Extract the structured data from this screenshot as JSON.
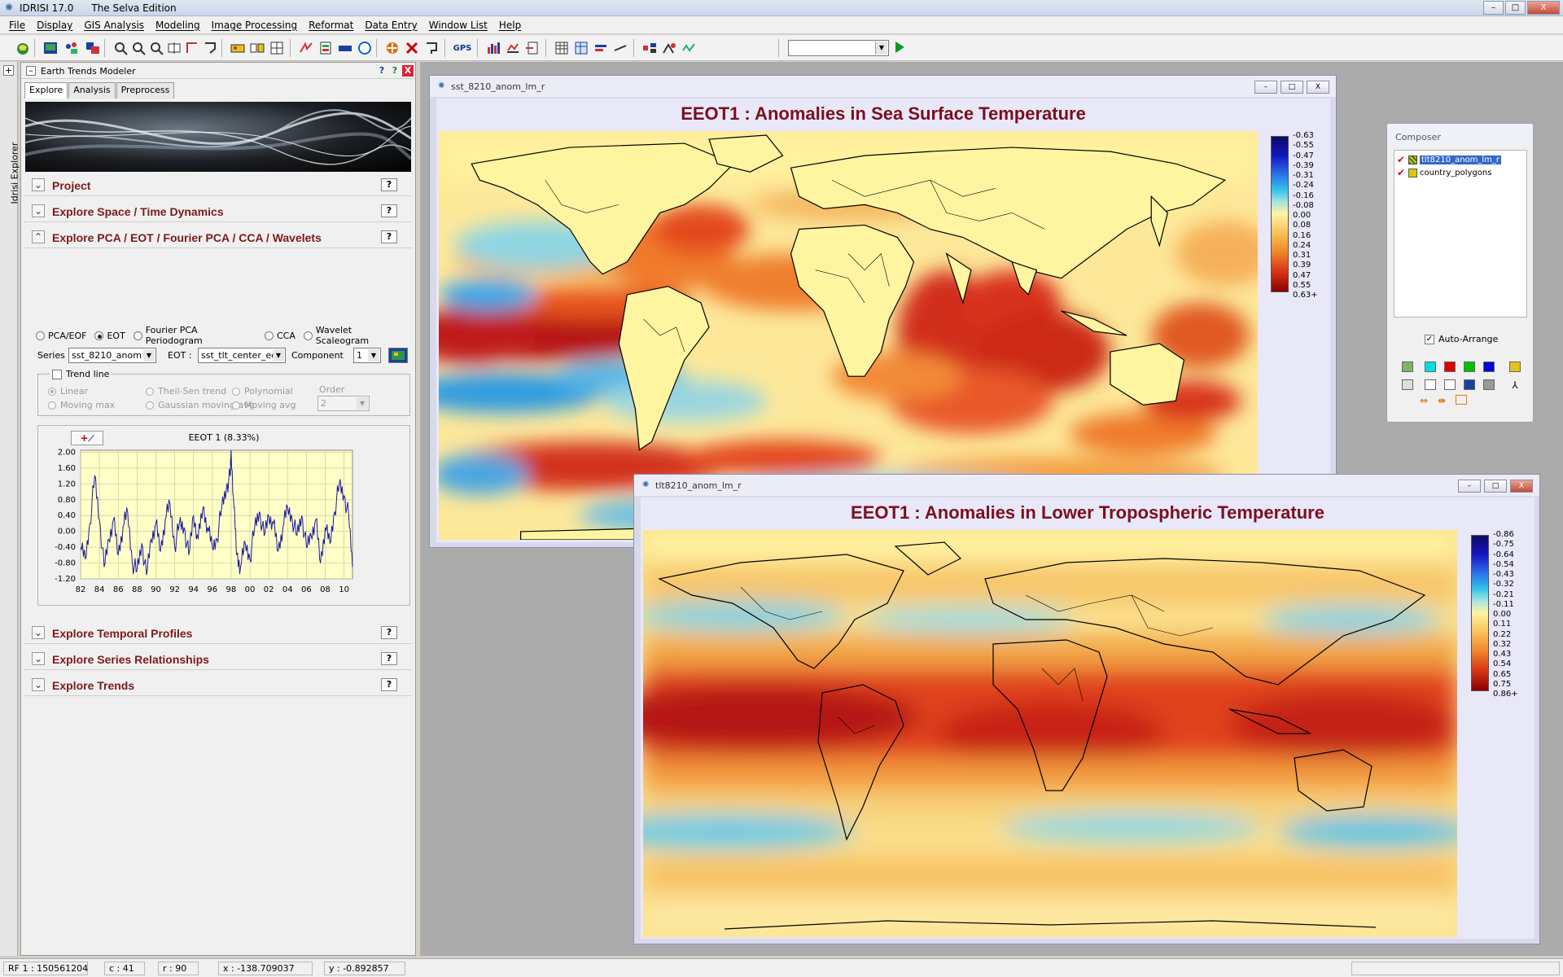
{
  "window": {
    "app_name": "IDRISI 17.0",
    "edition": "The Selva Edition",
    "min_label": "–",
    "max_label": "□",
    "close_label": "X"
  },
  "menu": [
    "File",
    "Display",
    "GIS Analysis",
    "Modeling",
    "Image Processing",
    "Reformat",
    "Data Entry",
    "Window List",
    "Help"
  ],
  "toolbar": {
    "gps_label": "GPS",
    "icons": [
      "new-project-icon",
      "display-launcher-icon",
      "add-layer-icon",
      "composer-icon",
      "zoom-window-icon",
      "zoom-in-icon",
      "zoom-out-icon",
      "pan-icon",
      "measure-icon",
      "query-icon",
      "digitize-icon",
      "shortcut-icon",
      "globe-icon",
      "feature-properties-icon",
      "delete-feature-icon",
      "save-digitized-icon",
      "gps-icon",
      "histogram-icon",
      "profile-icon",
      "export-icon",
      "grid-table-icon",
      "spreadsheet-icon",
      "stretch-icon",
      "legend-edit-icon",
      "macro-icon",
      "model-icon"
    ],
    "combo_value": "",
    "run_label": "run"
  },
  "side_strip": {
    "expand_label": "+",
    "vertical_label": "Idrisi Explorer"
  },
  "etm": {
    "title": "Earth Trends Modeler",
    "collapse_label": "–",
    "help_label": "?",
    "help2_label": "?",
    "close_label": "X",
    "tabs": [
      "Explore",
      "Analysis",
      "Preprocess"
    ],
    "sections_top": [
      "Project",
      "Explore Space / Time Dynamics",
      "Explore PCA / EOT / Fourier PCA / CCA / Wavelets"
    ],
    "sections_bottom": [
      "Explore Temporal Profiles",
      "Explore Series Relationships",
      "Explore Trends"
    ],
    "help_btn": "?",
    "radios": [
      {
        "label": "PCA/EOF",
        "selected": false
      },
      {
        "label": "EOT",
        "selected": true
      },
      {
        "label": "Fourier PCA Periodogram",
        "selected": false
      },
      {
        "label": "CCA",
        "selected": false
      },
      {
        "label": "Wavelet Scaleogram",
        "selected": false
      }
    ],
    "series_label": "Series :",
    "series_value": "sst_8210_anom",
    "eot_label": "EOT :",
    "eot_value": "sst_tlt_center_eec",
    "component_label": "Component",
    "component_value": "1",
    "trend_line_label": "Trend line",
    "trend_options": [
      "Linear",
      "Theil-Sen trend",
      "Polynomial",
      "Moving max",
      "Gaussian moving avg",
      "Moving avg"
    ],
    "order_label": "Order",
    "order_value": "2",
    "plot_button": "+",
    "chart_title": "EEOT 1 (8.33%)"
  },
  "chart_data": {
    "type": "line",
    "title": "EEOT 1 (8.33%)",
    "xlabel": "",
    "ylabel": "",
    "x_ticks": [
      "82",
      "84",
      "86",
      "88",
      "90",
      "92",
      "94",
      "96",
      "98",
      "00",
      "02",
      "04",
      "06",
      "08",
      "10"
    ],
    "y_ticks": [
      "2.00",
      "1.60",
      "1.20",
      "0.80",
      "0.40",
      "0.00",
      "-0.40",
      "-0.80",
      "-1.20"
    ],
    "xlim": [
      1982,
      2010.9
    ],
    "ylim": [
      -1.2,
      2.05
    ],
    "grid": true,
    "series": [
      {
        "color": "#1a1aa0",
        "x": [
          1982.0,
          1982.5,
          1983.0,
          1983.5,
          1984.0,
          1984.5,
          1985.0,
          1985.5,
          1986.0,
          1986.5,
          1987.0,
          1987.5,
          1988.0,
          1988.5,
          1989.0,
          1989.5,
          1990.0,
          1990.5,
          1991.0,
          1991.5,
          1992.0,
          1992.5,
          1993.0,
          1993.5,
          1994.0,
          1994.5,
          1995.0,
          1995.5,
          1996.0,
          1996.5,
          1997.0,
          1997.5,
          1997.9,
          1998.0,
          1998.3,
          1998.6,
          1999.0,
          1999.5,
          2000.0,
          2000.5,
          2001.0,
          2001.5,
          2002.0,
          2002.5,
          2003.0,
          2003.5,
          2004.0,
          2004.5,
          2005.0,
          2005.5,
          2006.0,
          2006.5,
          2007.0,
          2007.5,
          2008.0,
          2008.5,
          2009.0,
          2009.5,
          2010.0,
          2010.5,
          2010.9
        ],
        "y": [
          -0.4,
          -0.7,
          0.2,
          1.4,
          0.3,
          -0.9,
          -0.2,
          0.3,
          -0.6,
          0.1,
          0.5,
          -0.8,
          -1.0,
          -0.3,
          -1.1,
          -0.2,
          0.2,
          -0.5,
          0.3,
          0.7,
          -0.4,
          0.2,
          0.1,
          -0.6,
          0.4,
          -0.2,
          0.6,
          0.1,
          -0.4,
          -0.2,
          0.6,
          1.1,
          1.4,
          2.05,
          0.6,
          -0.6,
          -0.9,
          -0.3,
          -0.7,
          0.1,
          0.5,
          -0.1,
          0.4,
          0.2,
          -0.5,
          0.1,
          0.6,
          0.3,
          -0.1,
          0.4,
          -0.4,
          -0.1,
          0.3,
          -0.8,
          0.1,
          -0.3,
          0.5,
          1.2,
          0.9,
          0.4,
          -0.9
        ]
      }
    ]
  },
  "sst_window": {
    "title": "sst_8210_anom_lm_r",
    "heading": "EEOT1 : Anomalies in Sea Surface Temperature",
    "legend": [
      "-0.63",
      "-0.55",
      "-0.47",
      "-0.39",
      "-0.31",
      "-0.24",
      "-0.16",
      "-0.08",
      "0.00",
      "0.08",
      "0.16",
      "0.24",
      "0.31",
      "0.39",
      "0.47",
      "0.55",
      "0.63+"
    ]
  },
  "tlt_window": {
    "title": "tlt8210_anom_lm_r",
    "heading": "EEOT1 : Anomalies in Lower Tropospheric Temperature",
    "legend": [
      "-0.86",
      "-0.75",
      "-0.64",
      "-0.54",
      "-0.43",
      "-0.32",
      "-0.21",
      "-0.11",
      "0.00",
      "0.11",
      "0.22",
      "0.32",
      "0.43",
      "0.54",
      "0.65",
      "0.75",
      "0.86+"
    ]
  },
  "composer": {
    "title": "Composer",
    "layers": [
      {
        "name": "tlt8210_anom_lm_r",
        "selected": true
      },
      {
        "name": "country_polygons",
        "selected": false
      }
    ],
    "auto_arrange_label": "Auto-Arrange",
    "auto_arrange": true,
    "colors": {
      "cyan": "#00e0e0",
      "red": "#e00000",
      "green": "#00c000",
      "blue": "#0000e0"
    }
  },
  "status": {
    "rf": "RF 1 : 150561204",
    "c": "c : 41",
    "r": "r : 90",
    "x": "x : -138.709037",
    "y": "y : -0.892857"
  }
}
